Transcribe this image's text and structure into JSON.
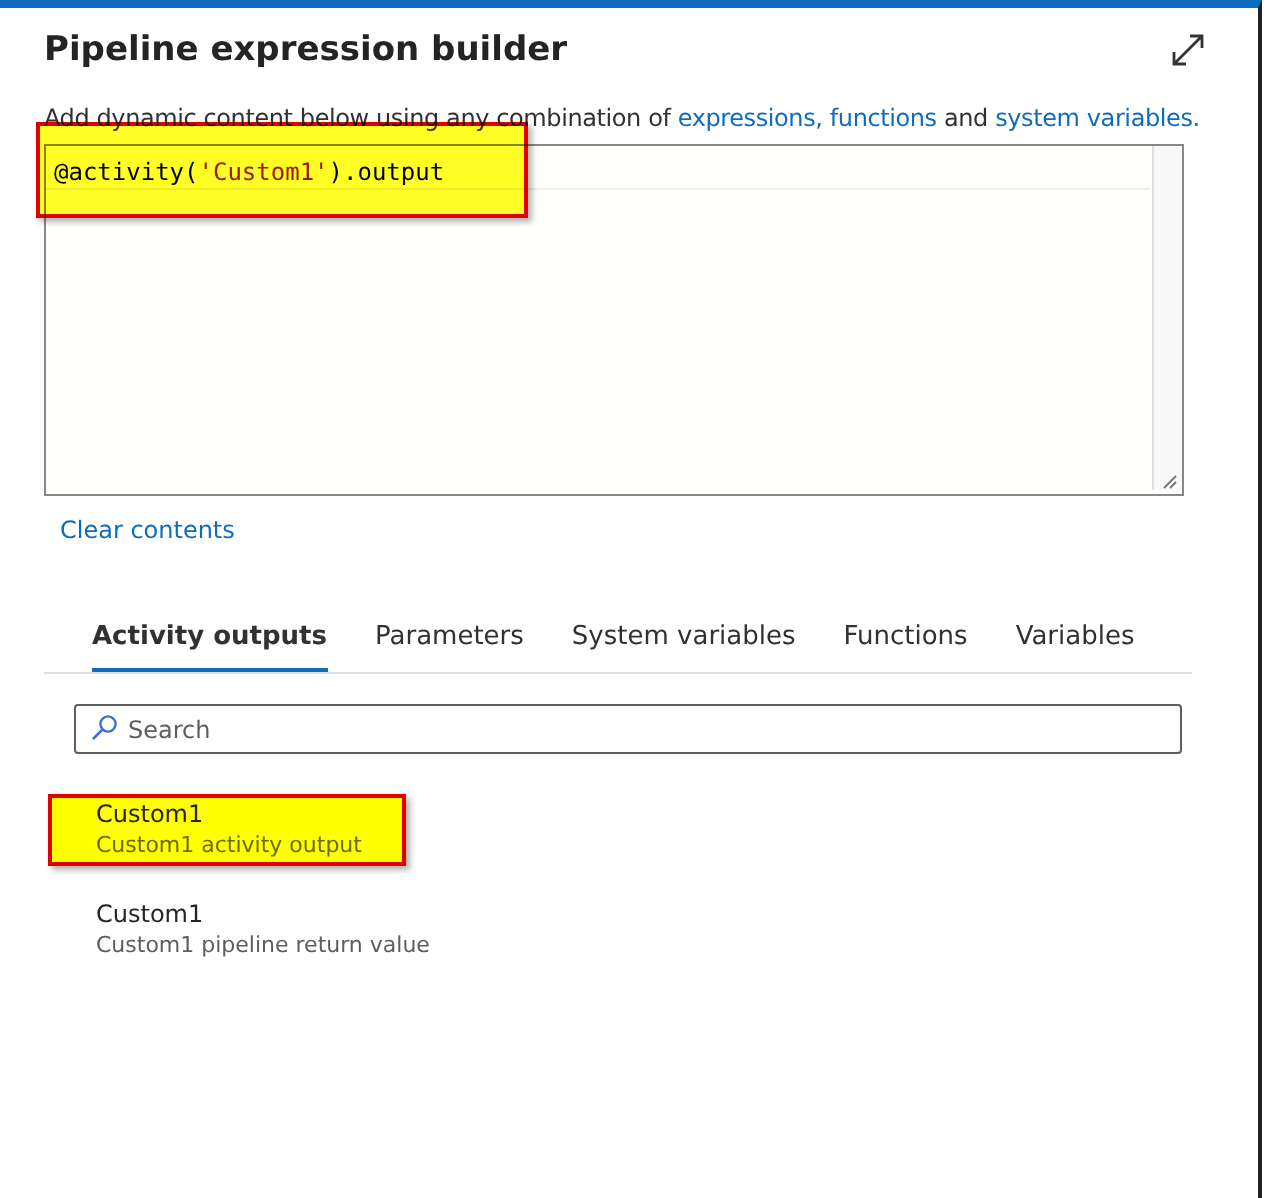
{
  "title": "Pipeline expression builder",
  "description": {
    "text": "Add dynamic content below using any combination of ",
    "links": [
      "expressions,",
      "functions"
    ],
    "joiner": "and",
    "last_link": "system variables."
  },
  "editor": {
    "highlighted": true,
    "tokens": [
      {
        "kind": "code",
        "text": "@activity("
      },
      {
        "kind": "string",
        "text": "'Custom1'"
      },
      {
        "kind": "code",
        "text": ").output"
      }
    ]
  },
  "clear_link": "Clear contents",
  "tabs": [
    {
      "label": "Activity outputs",
      "selected": true
    },
    {
      "label": "Parameters",
      "selected": false
    },
    {
      "label": "System variables",
      "selected": false
    },
    {
      "label": "Functions",
      "selected": false
    },
    {
      "label": "Variables",
      "selected": false
    }
  ],
  "search": {
    "placeholder": "Search"
  },
  "items": [
    {
      "name": "Custom1",
      "detail": "Custom1 activity output",
      "highlighted": true
    },
    {
      "name": "Custom1",
      "detail": "Custom1 pipeline return value",
      "highlighted": false
    }
  ]
}
